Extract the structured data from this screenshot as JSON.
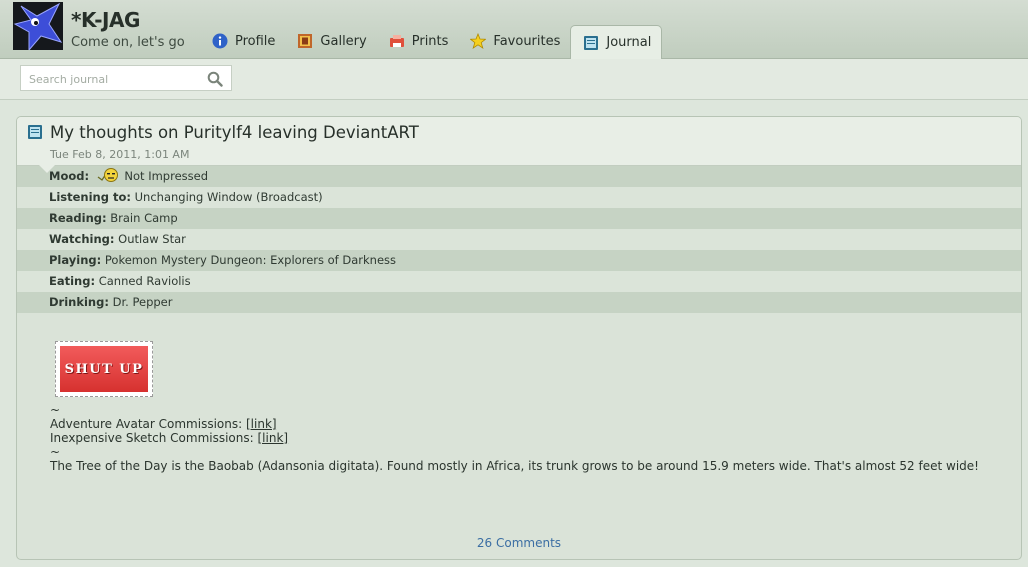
{
  "header": {
    "username": "*K-JAG",
    "tagline": "Come on, let's go",
    "tabs": [
      {
        "label": "Profile",
        "icon": "info-icon"
      },
      {
        "label": "Gallery",
        "icon": "gallery-icon"
      },
      {
        "label": "Prints",
        "icon": "prints-icon"
      },
      {
        "label": "Favourites",
        "icon": "star-icon"
      },
      {
        "label": "Journal",
        "icon": "journal-icon",
        "active": true
      }
    ]
  },
  "search": {
    "placeholder": "Search journal"
  },
  "journal": {
    "title": "My thoughts on Puritylf4 leaving DeviantART",
    "date": "Tue Feb 8, 2011, 1:01 AM",
    "moods": [
      {
        "label": "Mood:",
        "value": "Not Impressed"
      },
      {
        "label": "Listening to:",
        "value": "Unchanging Window (Broadcast)"
      },
      {
        "label": "Reading:",
        "value": "Brain Camp"
      },
      {
        "label": "Watching:",
        "value": "Outlaw Star"
      },
      {
        "label": "Playing:",
        "value": "Pokemon Mystery Dungeon: Explorers of Darkness"
      },
      {
        "label": "Eating:",
        "value": "Canned Raviolis"
      },
      {
        "label": "Drinking:",
        "value": "Dr. Pepper"
      }
    ],
    "stamp_text": "SHUT UP",
    "body": {
      "tilde1": "~",
      "line1_text": "Adventure Avatar Commissions: ",
      "line1_link": "[link]",
      "line2_text": "Inexpensive Sketch Commissions: ",
      "line2_link": "[link]",
      "tilde2": "~",
      "paragraph": "The Tree of the Day is the Baobab (Adansonia digitata). Found mostly in Africa, its trunk grows to be around 15.9 meters wide. That's almost 52 feet wide!"
    },
    "comments": "26 Comments"
  },
  "colors": {
    "accent_link": "#3b6ea3",
    "header_bg": "#c0cdbe",
    "page_bg": "#dde6dc"
  }
}
